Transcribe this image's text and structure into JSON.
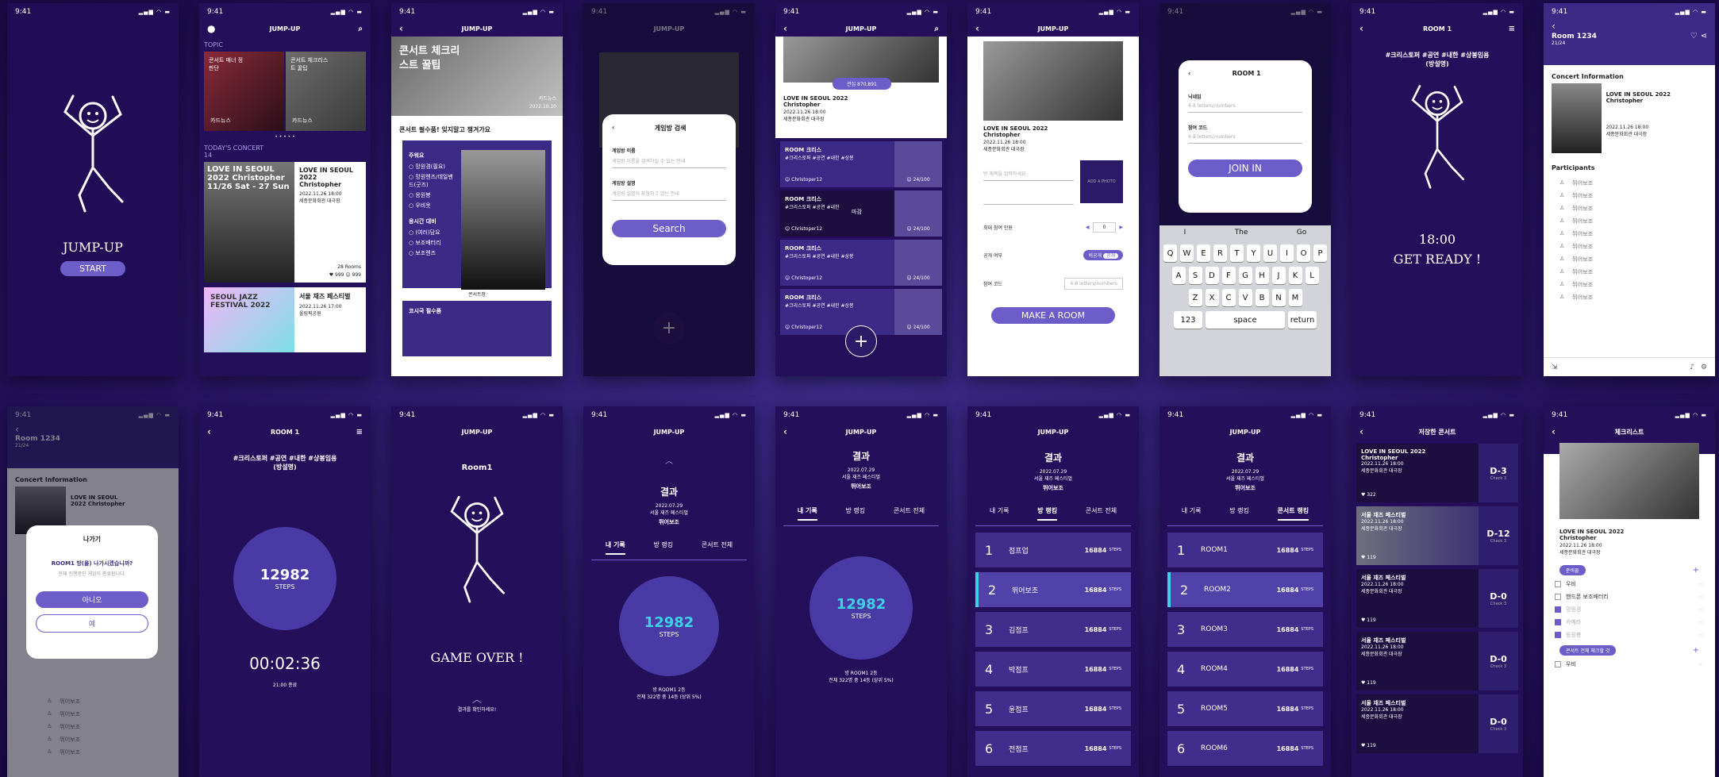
{
  "time": "9:41",
  "app": "JUMP-UP",
  "s1": {
    "title": "JUMP-UP",
    "start": "START"
  },
  "s2": {
    "topic": "TOPIC",
    "t1": "콘서트 매너 정 판단",
    "t1b": "카드뉴스",
    "t2": "콘서트 체크리스트 꿀팁",
    "t2b": "카드뉴스",
    "today": "TODAY'S CONCERT",
    "today_count": "14",
    "c1_title": "LOVE IN SEOUL 2022 Christopher",
    "c1_date": "2022.11.26 18:00",
    "c1_place": "세종문화회관 대극장",
    "c1_poster": "LOVE IN SEOUL 2022 Christopher 11/26 Sat - 27 Sun",
    "c1_rooms": "28 Rooms",
    "c1_likes": "999",
    "c1_users": "999",
    "c2_title": "서울 재즈 페스티벌",
    "c2_date": "2022.11.26 17:00",
    "c2_place": "올림픽공원",
    "c2_poster": "SEOUL JAZZ FESTIVAL 2022"
  },
  "s3": {
    "banner": "콘서트 체크리스트 꿀팁",
    "banner_tag": "카드뉴스",
    "banner_date": "2022.10.10",
    "subtitle": "콘서트 필수품! 잊지말고 챙겨가요",
    "sec1": "주워요",
    "items1": [
      "망원경(필요)",
      "망원렌즈/데일밴드(굿즈)",
      "응원봉",
      "우비옷"
    ],
    "sec2": "응시간 대비",
    "items2": [
      "(여러)담요",
      "보조배터리",
      "보조렌즈"
    ],
    "photo_caption": "콘서트장",
    "sec3": "코시국 필수품"
  },
  "s4": {
    "modal_title": "게임방 검색",
    "name_label": "게임방 이름",
    "name_ph": "게임방 이름을 검색하실 수 있는 안내",
    "desc_label": "게임방 설명",
    "desc_ph": "게임방 설명이 포함하고 있는 안내",
    "search": "Search"
  },
  "s5": {
    "likes": "관심 870,891",
    "title": "LOVE IN SEOUL 2022 Christopher",
    "date": "2022.11.26 18:00",
    "place": "세종문화회관 대극장",
    "rooms": [
      {
        "name": "ROOM 크리스",
        "tags": "#크리스토퍼 #공연 #내한 #상봉",
        "user": "Christoper12",
        "count": "24/100"
      },
      {
        "name": "ROOM 크리스",
        "tags": "#크리스토퍼 #공연 #내한",
        "user": "Christoper12",
        "count": "24/100"
      },
      {
        "name": "ROOM 크리스",
        "tags": "#크리스토퍼 #공연 #내한 #상봉",
        "user": "Christoper12",
        "count": "24/100"
      },
      {
        "name": "ROOM 크리스",
        "tags": "#크리스토퍼 #공연 #내한 #상봉",
        "user": "Christoper12",
        "count": "24/100"
      }
    ],
    "full": "마감"
  },
  "s6": {
    "title": "LOVE IN SEOUL 2022 Christopher",
    "date": "2022.11.26 18:00",
    "place": "세종문화회관 대극장",
    "name_ph": "방 제목을 입력하세요",
    "img_ph": "ADD A PHOTO",
    "max_label": "최대 참여 인원",
    "max_val": "0",
    "public_label": "공개 여부",
    "private": "비공개",
    "public": "공개",
    "code_label": "참여 코드",
    "code_ph": "4-8 letters/numbers",
    "make": "MAKE A ROOM"
  },
  "s7": {
    "room": "ROOM 1",
    "nick": "닉네임",
    "nick_ph": "4-8 letters/numbers",
    "code": "참여 코드",
    "code_ph": "4-8 letters/numbers",
    "join": "JOIN IN",
    "sugg": [
      "I",
      "The",
      "Go"
    ],
    "r1": [
      "Q",
      "W",
      "E",
      "R",
      "T",
      "Y",
      "U",
      "I",
      "O",
      "P"
    ],
    "r2": [
      "A",
      "S",
      "D",
      "F",
      "G",
      "H",
      "J",
      "K",
      "L"
    ],
    "r3": [
      "Z",
      "X",
      "C",
      "V",
      "B",
      "N",
      "M"
    ],
    "k123": "123",
    "space": "space",
    "ret": "return"
  },
  "s8": {
    "head": "ROOM 1",
    "tags": "#크리스토퍼 #공연 #내한 #상봉임용(방설명)",
    "time": "18:00",
    "ready": "GET READY !"
  },
  "s9": {
    "room": "Room 1234",
    "count": "21/24",
    "info": "Concert Information",
    "title": "LOVE IN SEOUL 2022 Christopher",
    "date": "2022.11.26 18:00",
    "place": "세종문화회관 대극장",
    "participants": "Participants",
    "names": [
      "뛰어보조",
      "뛰어보조",
      "뛰어보조",
      "뛰어보조",
      "뛰어보조",
      "뛰어보조",
      "뛰어보조",
      "뛰어보조",
      "뛰어보조",
      "뛰어보조"
    ]
  },
  "s10": {
    "room": "Room 1234",
    "count": "21/24",
    "info": "Concert Information",
    "title": "LOVE IN SEOUL 2022 Christopher",
    "modal_title": "나가기",
    "question": "ROOM1 방(을) 나가시겠습니까?",
    "sub": "현재 진행중인 게임이 종료됩니다.",
    "no": "아니오",
    "yes": "예",
    "names": [
      "뛰어보조",
      "뛰어보조",
      "뛰어보조",
      "뛰어보조",
      "뛰어보조"
    ]
  },
  "s11": {
    "head": "ROOM 1",
    "tags": "#크리스토퍼 #공연 #내한 #상봉임용(방설명)",
    "steps": "12982",
    "steps_label": "STEPS",
    "timer": "00:02:36",
    "end": "21:00 종료"
  },
  "s12": {
    "room": "Room1",
    "over": "GAME OVER !",
    "hint": "결과를 확인하세요!"
  },
  "s13": {
    "result": "결과",
    "date": "2022.07.29",
    "concert": "서울 재즈 페스티벌",
    "user": "뛰어보조",
    "tabs": [
      "내 기록",
      "방 랭킹",
      "콘서트 전체"
    ],
    "steps": "12982",
    "steps_label": "STEPS",
    "rank": "방 ROOM1 2등",
    "rank2": "전체 322명 중 14등 (상위 5%)"
  },
  "s14": {
    "result": "결과",
    "date": "2022.07.29",
    "concert": "서울 재즈 페스티벌",
    "user": "뛰어보조",
    "tabs": [
      "내 기록",
      "방 랭킹",
      "콘서트 전체"
    ],
    "steps": "12982",
    "steps_label": "STEPS",
    "rank": "방 ROOM1 2등",
    "rank2": "전체 322명 중 14등 (상위 5%)"
  },
  "s15": {
    "result": "결과",
    "date": "2022.07.29",
    "concert": "서울 재즈 페스티벌",
    "user": "뛰어보조",
    "tabs": [
      "내 기록",
      "방 랭킹",
      "콘서트 전체"
    ],
    "rows": [
      {
        "n": "1",
        "name": "점프업",
        "steps": "16884"
      },
      {
        "n": "2",
        "name": "뛰어보조",
        "steps": "16884"
      },
      {
        "n": "3",
        "name": "김점프",
        "steps": "16884"
      },
      {
        "n": "4",
        "name": "박점프",
        "steps": "16884"
      },
      {
        "n": "5",
        "name": "윤점프",
        "steps": "16884"
      },
      {
        "n": "6",
        "name": "전점프",
        "steps": "16884"
      }
    ],
    "unit": "STEPS"
  },
  "s16": {
    "result": "결과",
    "date": "2022.07.29",
    "concert": "서울 재즈 페스티벌",
    "user": "뛰어보조",
    "tabs": [
      "내 기록",
      "방 랭킹",
      "콘서트 랭킹"
    ],
    "rows": [
      {
        "n": "1",
        "name": "ROOM1",
        "steps": "16884"
      },
      {
        "n": "2",
        "name": "ROOM2",
        "steps": "16884"
      },
      {
        "n": "3",
        "name": "ROOM3",
        "steps": "16884"
      },
      {
        "n": "4",
        "name": "ROOM4",
        "steps": "16884"
      },
      {
        "n": "5",
        "name": "ROOM5",
        "steps": "16884"
      },
      {
        "n": "6",
        "name": "ROOM6",
        "steps": "16884"
      }
    ],
    "unit": "STEPS"
  },
  "s17": {
    "head": "저장한 콘서트",
    "items": [
      {
        "title": "LOVE IN SEOUL 2022 Christopher",
        "date": "2022.11.26 18:00",
        "place": "세종문화회관 대극장",
        "likes": "322",
        "dday": "D-3",
        "check": "Check 3"
      },
      {
        "title": "서울 재즈 페스티벌",
        "date": "2022.11.26 18:00",
        "place": "세종문화회관 대극장",
        "likes": "119",
        "dday": "D-12",
        "check": "Check 3"
      },
      {
        "title": "서울 재즈 페스티벌",
        "date": "2022.11.26 18:00",
        "place": "세종문화회관 대극장",
        "likes": "119",
        "dday": "D-0",
        "check": "Check 3"
      },
      {
        "title": "서울 재즈 페스티벌",
        "date": "2022.11.26 18:00",
        "place": "세종문화회관 대극장",
        "likes": "119",
        "dday": "D-0",
        "check": "Check 3"
      },
      {
        "title": "서울 재즈 페스티벌",
        "date": "2022.11.26 18:00",
        "place": "세종문화회관 대극장",
        "likes": "119",
        "dday": "D-0",
        "check": "Check 3"
      }
    ]
  },
  "s18": {
    "head": "체크리스트",
    "title": "LOVE IN SEOUL 2022 Christopher",
    "date": "2022.11.26 18:00",
    "place": "세종문화회관 대극장",
    "tag1": "준비물",
    "items1": [
      "우비",
      "핸드폰 보조배터리",
      "망원경",
      "카메라",
      "응원봉"
    ],
    "tag2": "콘서트 전체 체크할 것",
    "items2": [
      "우비"
    ]
  }
}
